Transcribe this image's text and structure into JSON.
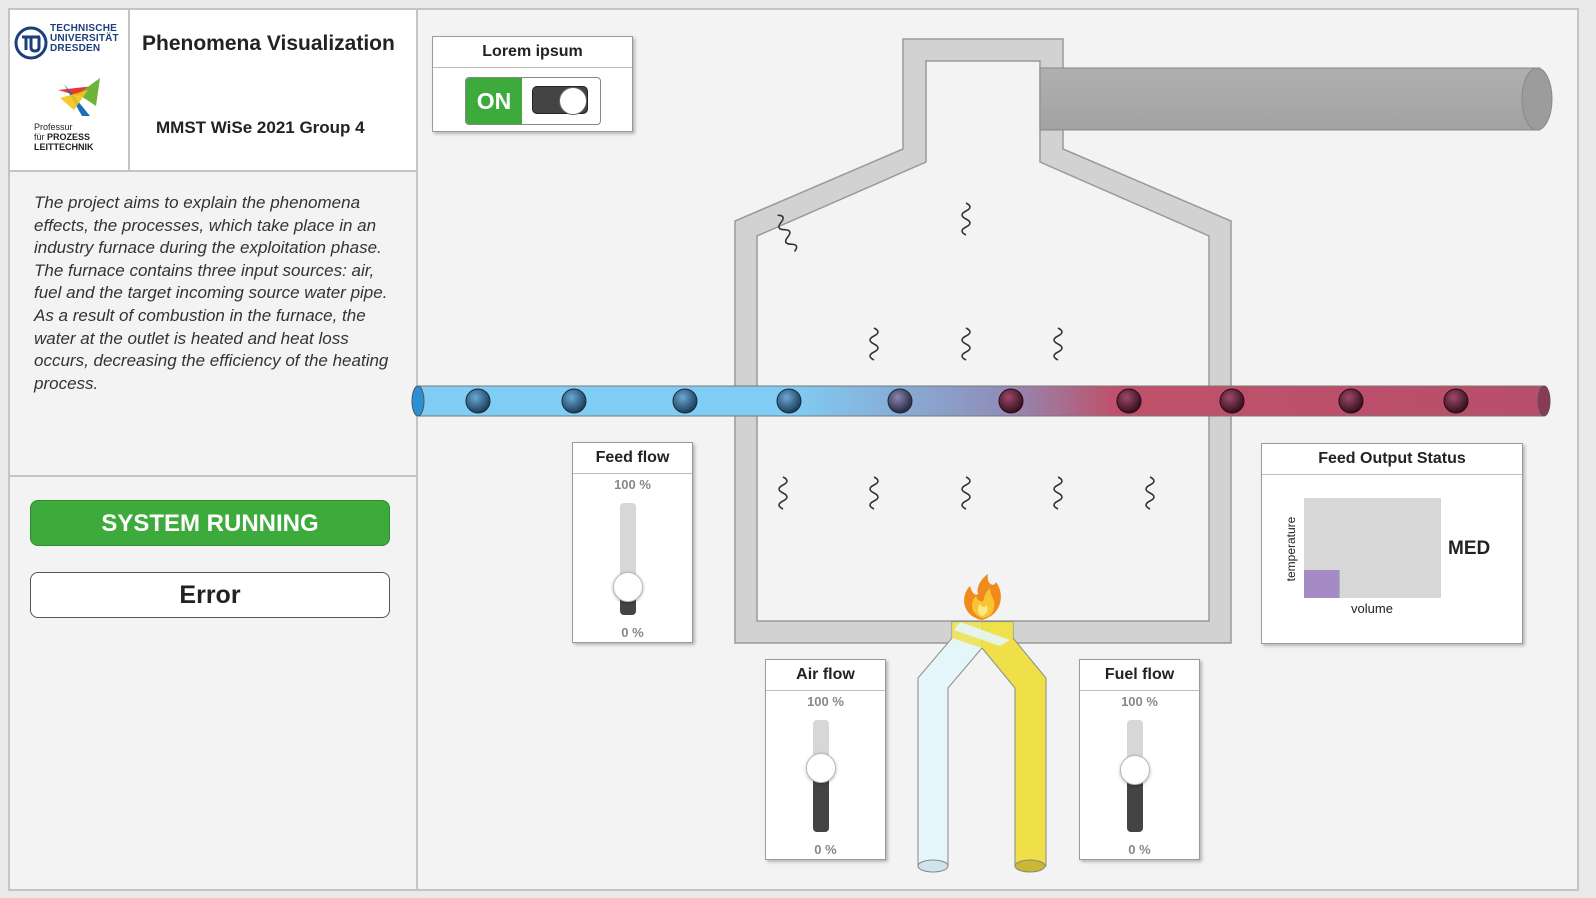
{
  "header": {
    "title": "Phenomena Visualization",
    "subtitle": "MMST WiSe 2021 Group 4",
    "tu_logo": {
      "line1": "TECHNISCHE",
      "line2": "UNIVERSITÄT",
      "line3": "DRESDEN"
    },
    "plt_logo": {
      "line1": "Professur",
      "line2": "für",
      "line2b": "PROZESS",
      "line3": "LEITTECHNIK"
    }
  },
  "description": [
    "The project aims to explain the phenomena effects, the processes, which take place in an industry furnace during the exploitation phase.",
    "The furnace contains three input sources: air, fuel and the target incoming source water pipe.",
    "As a result of combustion in the furnace, the water at the outlet is heated and heat loss occurs, decreasing the efficiency of the heating process."
  ],
  "status": {
    "running_label": "SYSTEM RUNNING",
    "error_label": "Error",
    "running_color": "#3cab3c"
  },
  "power": {
    "title": "Lorem ipsum",
    "state_label": "ON",
    "on": true
  },
  "feed_flow": {
    "title": "Feed flow",
    "max_label": "100 %",
    "min_label": "0 %",
    "value_pct": 25
  },
  "air_flow": {
    "title": "Air flow",
    "max_label": "100 %",
    "min_label": "0 %",
    "value_pct": 57
  },
  "fuel_flow": {
    "title": "Fuel flow",
    "max_label": "100 %",
    "min_label": "0 %",
    "value_pct": 55
  },
  "output_status": {
    "title": "Feed Output Status",
    "xlabel": "volume",
    "ylabel": "temperature",
    "level": "MED",
    "fill_fraction_x": 0.26,
    "fill_fraction_y": 0.28,
    "fill_color": "#a58bc4"
  },
  "colors": {
    "cold_water": "#7fcdf4",
    "hot_water": "#c0506a",
    "fuel": "#efe04a",
    "air": "#e4f6fa",
    "exhaust": "#a9a9a9"
  },
  "icons": {
    "flame": "flame-icon",
    "heat_wave": "heat-wave-icon",
    "water_bubble": "water-bubble-icon"
  }
}
